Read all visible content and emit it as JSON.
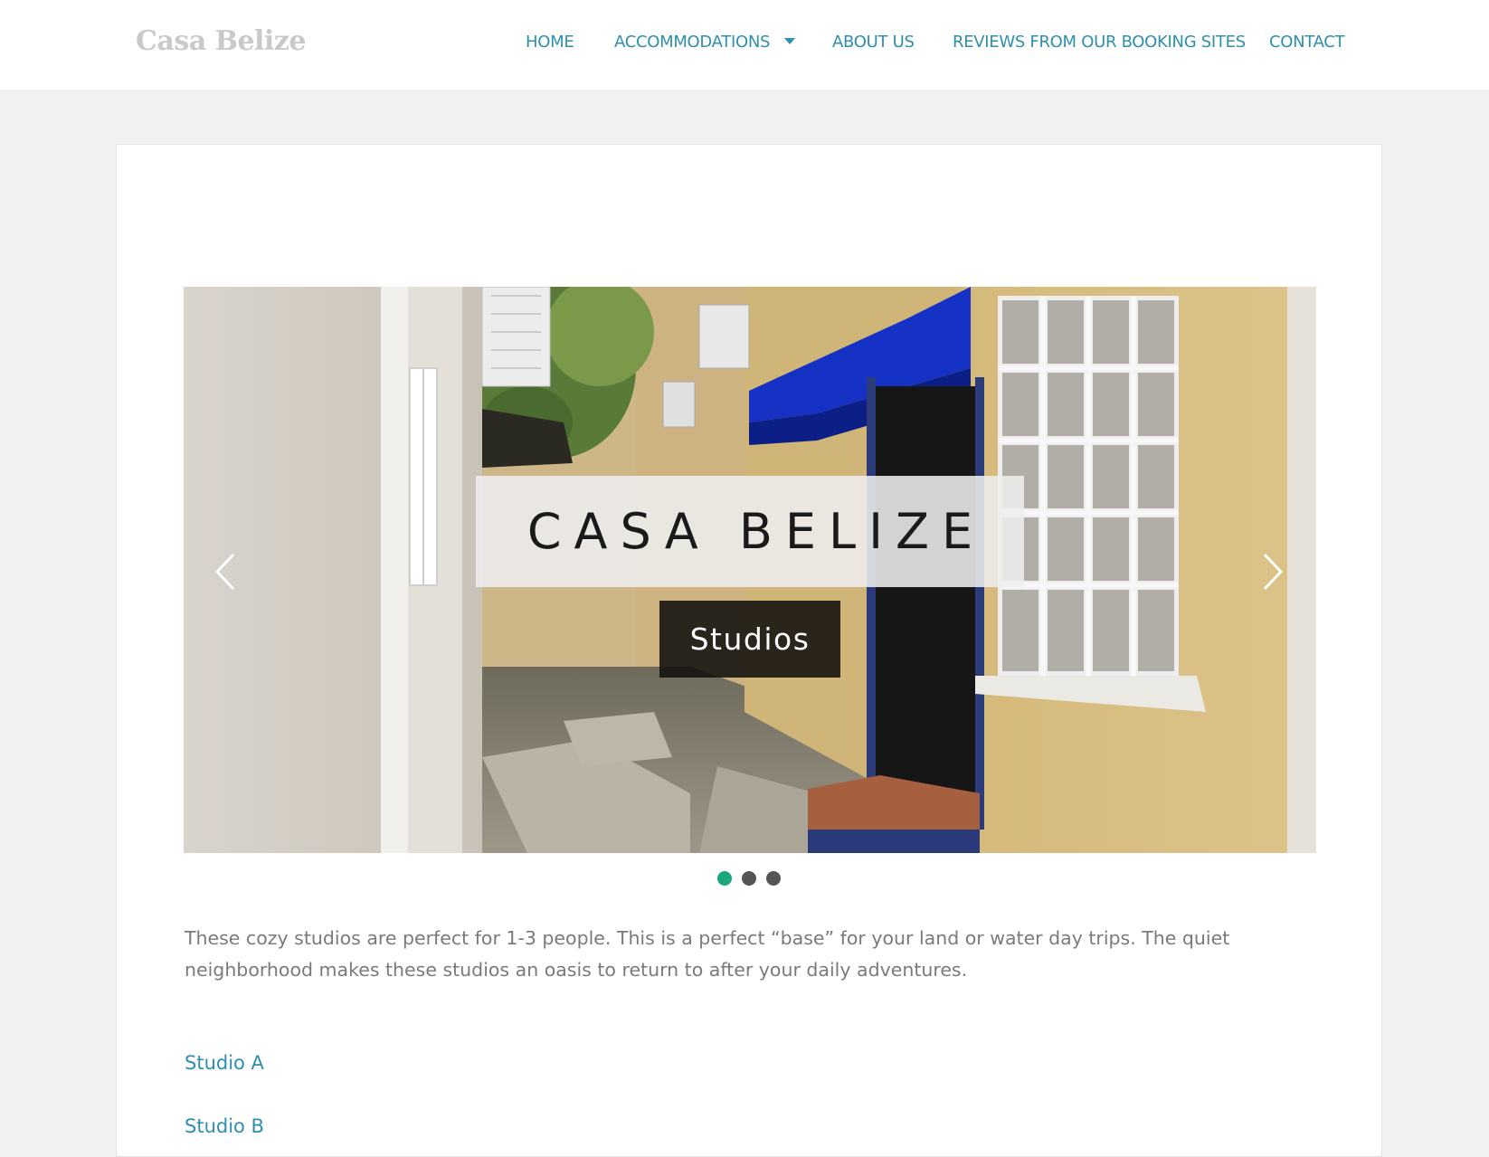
{
  "site": {
    "title": "Casa Belize"
  },
  "nav": {
    "items": [
      {
        "label": "HOME"
      },
      {
        "label": "ACCOMMODATIONS",
        "has_dropdown": true
      },
      {
        "label": "ABOUT US"
      },
      {
        "label": "REVIEWS FROM OUR BOOKING SITES"
      },
      {
        "label": "CONTACT"
      }
    ],
    "link_color": "#2e8fae"
  },
  "slider": {
    "title": "CASA BELIZE",
    "subtitle": "Studios",
    "prev_icon": "chevron-left-icon",
    "next_icon": "chevron-right-icon",
    "slide_count": 3,
    "active_slide": 1,
    "active_dot_color": "#1aa77e",
    "inactive_dot_color": "#555555"
  },
  "content": {
    "intro": "These cozy studios are perfect for 1-3 people. This is a perfect “base” for your land or water day trips. The quiet neighborhood makes these studios an oasis to return to after your daily adventures.",
    "links": [
      {
        "label": "Studio A"
      },
      {
        "label": "Studio B"
      }
    ]
  }
}
